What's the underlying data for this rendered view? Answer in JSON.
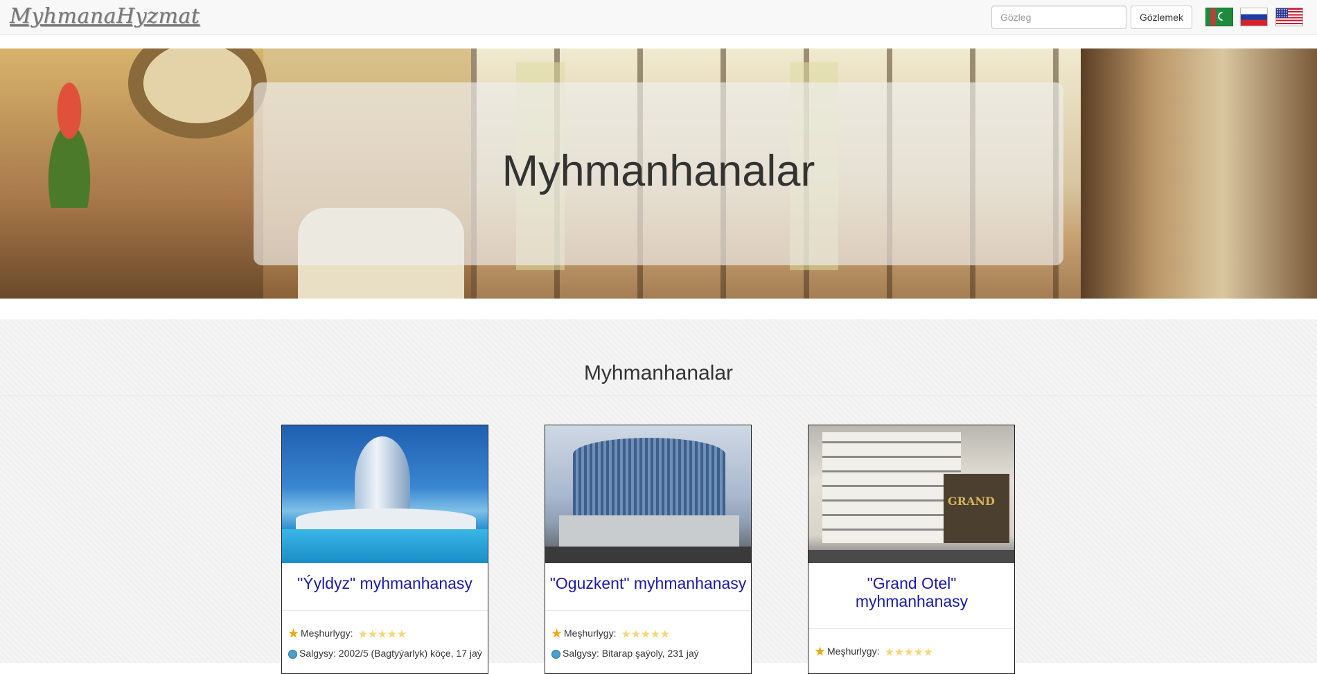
{
  "navbar": {
    "brand": "MyhmanaHyzmat",
    "search_placeholder": "Gözleg",
    "search_button": "Gözlemek",
    "flags": [
      "turkmen-flag",
      "russian-flag",
      "us-flag"
    ]
  },
  "hero": {
    "title": "Myhmanhanalar"
  },
  "section": {
    "title": "Myhmanhanalar"
  },
  "hotels": [
    {
      "name": "\"Ýyldyz\" myhmanhanasy",
      "rating_label": "Meşhurlygy:",
      "rating": 5,
      "address": "Salgysy: 2002/5 (Bagtyýarlyk) köçe, 17 jaý"
    },
    {
      "name": "\"Oguzkent\" myhmanhanasy",
      "rating_label": "Meşhurlygy:",
      "rating": 5,
      "address": "Salgysy: Bitarap şaýoly, 231 jaý"
    },
    {
      "name": "\"Grand Otel\" myhmanhanasy",
      "rating_label": "Meşhurlygy:",
      "rating": 5,
      "address": ""
    }
  ],
  "grand_sign": "GRAND",
  "colors": {
    "link": "#1a1aa6",
    "navbar_bg": "#f8f8f8",
    "star": "#f0a810"
  }
}
